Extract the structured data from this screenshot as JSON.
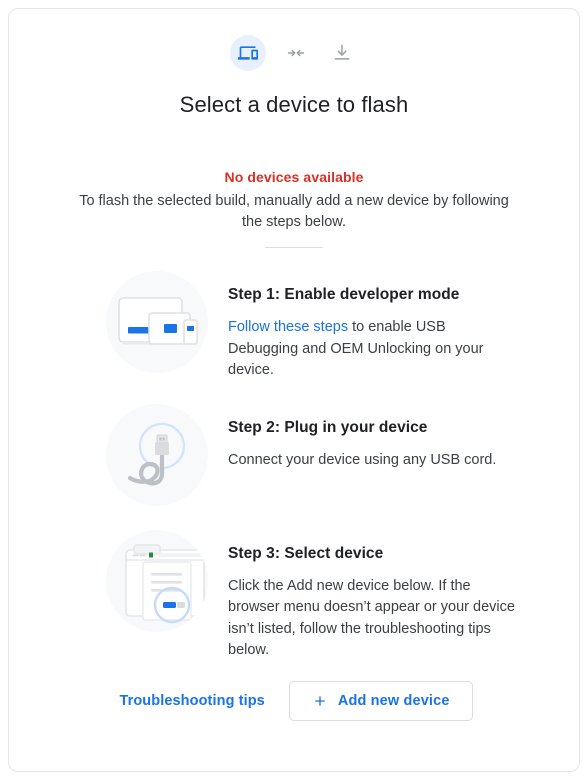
{
  "header": {
    "icons": [
      {
        "name": "devices-icon",
        "label": "devices",
        "active": true
      },
      {
        "name": "compress-arrows-icon",
        "label": "merge"
      },
      {
        "name": "download-icon",
        "label": "download"
      }
    ],
    "title": "Select a device to flash"
  },
  "status": {
    "error": "No devices available",
    "description": "To flash the selected build, manually add a new device by following the steps below."
  },
  "steps": [
    {
      "art": "devices-art",
      "title": "Step 1: Enable developer mode",
      "link_text": "Follow these steps",
      "text_after_link": " to enable USB Debugging and OEM Unlocking on your device."
    },
    {
      "art": "usb-cable-art",
      "title": "Step 2: Plug in your device",
      "text": "Connect your device using any USB cord."
    },
    {
      "art": "browser-picker-art",
      "title": "Step 3: Select device",
      "text": "Click the Add new device below. If the browser menu doesn’t appear or your device isn’t listed, follow the troubleshooting tips below."
    }
  ],
  "footer": {
    "troubleshooting_label": "Troubleshooting tips",
    "add_device_label": "Add new device",
    "add_device_icon": "plus-icon"
  },
  "colors": {
    "accent_blue": "#1a73e8",
    "error_red": "#d93025",
    "text_primary": "#202124",
    "text_secondary": "#3c4043",
    "chip_bg": "#e8f0fe",
    "art_bg": "#f8f9fa",
    "border": "#dadce0"
  }
}
